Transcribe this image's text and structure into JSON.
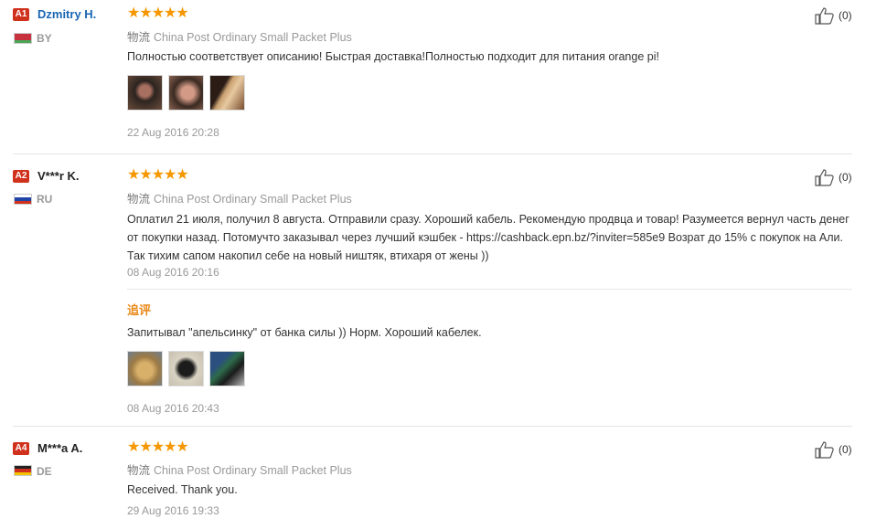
{
  "reviews": [
    {
      "level": "A1",
      "name": "Dzmitry H.",
      "country": "BY",
      "flag_colors": [
        "#c8313e",
        "#4aa657"
      ],
      "rating": "★★★★★",
      "logistics_label": "物流",
      "logistics": "China Post Ordinary Small Packet Plus",
      "text": "Полностью соответствует описанию! Быстрая доставка!Полностью подходит для питания orange pi!",
      "photos": [
        "photo-1",
        "photo-2",
        "photo-3"
      ],
      "date": "22 Aug 2016 20:28",
      "helpful": "(0)"
    },
    {
      "level": "A2",
      "name": "V***r K.",
      "country": "RU",
      "flag_colors": [
        "#ffffff",
        "#2145a6",
        "#d0311d"
      ],
      "rating": "★★★★★",
      "logistics_label": "物流",
      "logistics": "China Post Ordinary Small Packet Plus",
      "text": "Оплатил 21 июля, получил 8 августа. Отправили сразу. Хороший кабель. Рекомендую продвца и товар! Разумеется вернул часть денег от покупки назад. Потомучто заказывал через лучший кэшбек - https://cashback.epn.bz/?inviter=585e9 Возрат до 15% с покупок на Али. Так тихим сапом накопил себе на новый ништяк, втихаря от жены ))",
      "date": "08 Aug 2016 20:16",
      "append_label": "追评",
      "append_text": "Запитывал \"апельсинку\" от банка силы )) Норм. Хороший кабелек.",
      "append_photos": [
        "photo-1",
        "photo-2",
        "photo-3"
      ],
      "append_date": "08 Aug 2016 20:43",
      "helpful": "(0)"
    },
    {
      "level": "A4",
      "name": "M***a A.",
      "country": "DE",
      "flag_colors": [
        "#222222",
        "#d0311d",
        "#f5c400"
      ],
      "rating": "★★★★★",
      "logistics_label": "物流",
      "logistics": "China Post Ordinary Small Packet Plus",
      "text": "Received. Thank you.",
      "date": "29 Aug 2016 19:33",
      "helpful": "(0)"
    }
  ]
}
